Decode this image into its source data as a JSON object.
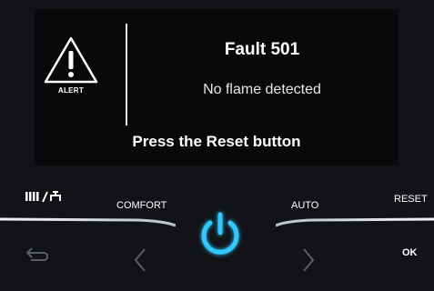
{
  "display": {
    "alert_label": "ALERT",
    "fault_title": "Fault 501",
    "fault_description": "No flame detected",
    "instruction": "Press the Reset button"
  },
  "controls": {
    "mode_icon": "radiator-tap-icon",
    "comfort_label": "COMFORT",
    "auto_label": "AUTO",
    "reset_label": "RESET",
    "ok_label": "OK",
    "power_icon": "power-icon",
    "back_icon": "back-arrow-icon",
    "prev_icon": "chevron-left-icon",
    "next_icon": "chevron-right-icon"
  },
  "colors": {
    "accent_glow": "#2fc9ff",
    "text": "#ffffff",
    "dim_icon": "#5a5d63"
  }
}
